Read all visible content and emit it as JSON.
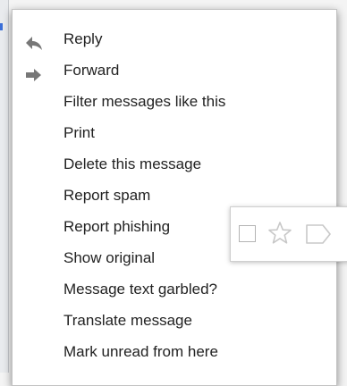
{
  "menu": {
    "items": [
      {
        "label": "Reply",
        "icon": "reply-icon"
      },
      {
        "label": "Forward",
        "icon": "forward-icon"
      },
      {
        "label": "Filter messages like this"
      },
      {
        "label": "Print"
      },
      {
        "label": "Delete this message"
      },
      {
        "label": "Report spam"
      },
      {
        "label": "Report phishing"
      },
      {
        "label": "Show original"
      },
      {
        "label": "Message text garbled?"
      },
      {
        "label": "Translate message"
      },
      {
        "label": "Mark unread from here"
      }
    ]
  },
  "toolbar": {
    "icons": [
      "checkbox-icon",
      "star-icon",
      "label-icon"
    ]
  },
  "colors": {
    "menu_text": "#222222",
    "icon": "#777777",
    "toolbar_icon": "#c8c8c8",
    "accent_mark": "#3b6fd8"
  }
}
